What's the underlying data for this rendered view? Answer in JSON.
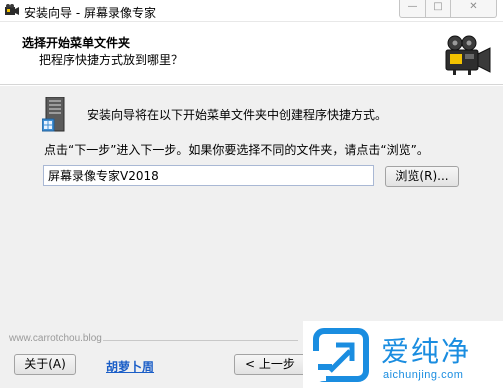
{
  "window": {
    "title": "安装向导 - 屏幕录像专家",
    "controls": {
      "minimize": "—",
      "maximize": "□",
      "close": "✕"
    }
  },
  "header": {
    "title": "选择开始菜单文件夹",
    "subtitle": "把程序快捷方式放到哪里？",
    "icon": "camera-icon"
  },
  "body": {
    "intro": "安装向导将在以下开始菜单文件夹中创建程序快捷方式。",
    "instruction": "点击“下一步”进入下一步。如果你要选择不同的文件夹，请点击“浏览”。",
    "folder_value": "屏幕录像专家V2018",
    "browse_label": "浏览(R)...",
    "folder_icon": "program-folder-icon"
  },
  "footer": {
    "watermark_url": "www.carrotchou.blog",
    "about_label": "关于(A)",
    "author_link": "胡萝卜周",
    "back_label": "< 上一步(B)"
  },
  "brand": {
    "name": "爱纯净",
    "url": "aichunjing.com",
    "logo_icon": "brand-logo-icon",
    "color": "#1a8de0"
  }
}
